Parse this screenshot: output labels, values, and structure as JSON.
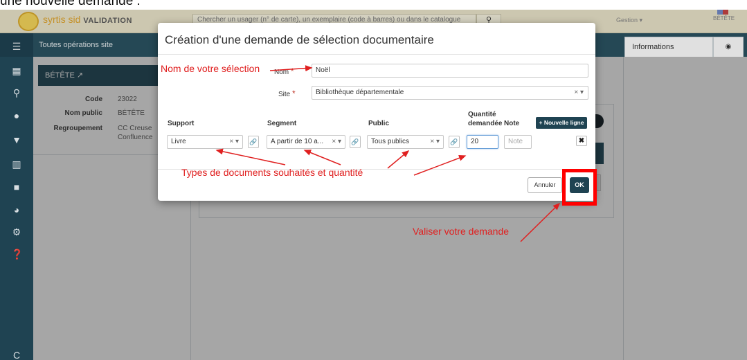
{
  "caption_top": "une nouvelle demande :",
  "app": {
    "logo_text": "syrtis sid",
    "logo_env": "VALIDATION",
    "search_placeholder": "Chercher un usager (n° de carte), un exemplaire (code à barres) ou dans le catalogue",
    "gestion_menu": "Gestion ▾",
    "user": "BÉTÊTE",
    "subbar_label": "Toutes opérations site",
    "info_tab": "Informations",
    "card_title": "BÉTÊTE",
    "fields": [
      {
        "label": "Code",
        "value": "23022"
      },
      {
        "label": "Nom public",
        "value": "BÉTÊTE"
      },
      {
        "label": "Regroupement",
        "value": "CC Creuse"
      },
      {
        "label": "",
        "value": "Confluence"
      }
    ],
    "sidebar_icons": [
      "address-book-icon",
      "search-icon",
      "drop-icon",
      "handshake-icon",
      "books-icon",
      "truck-icon",
      "pie-chart-icon",
      "gear-icon",
      "help-icon",
      "c-icon"
    ]
  },
  "modal": {
    "title": "Création d'une demande de sélection documentaire",
    "nom_label": "Nom",
    "nom_value": "Noël",
    "site_label": "Site",
    "site_value": "Bibliothèque départementale",
    "columns": {
      "support": "Support",
      "segment": "Segment",
      "public": "Public",
      "quantite_1": "Quantité",
      "quantite_2": "demandée",
      "note": "Note"
    },
    "new_line_label": "+ Nouvelle ligne",
    "row": {
      "support": "Livre",
      "segment": "A partir de 10 a...",
      "public": "Tous publics",
      "quantite": "20",
      "note_placeholder": "Note"
    },
    "cancel_label": "Annuler",
    "ok_label": "OK"
  },
  "annotations": {
    "nom": "Nom de votre sélection",
    "types": "Types de documents souhaités et quantité",
    "valider": "Valiser votre demande"
  },
  "colors": {
    "annotation": "#e02020",
    "primary_dark": "#1f4352",
    "highlight": "#ff0000"
  }
}
